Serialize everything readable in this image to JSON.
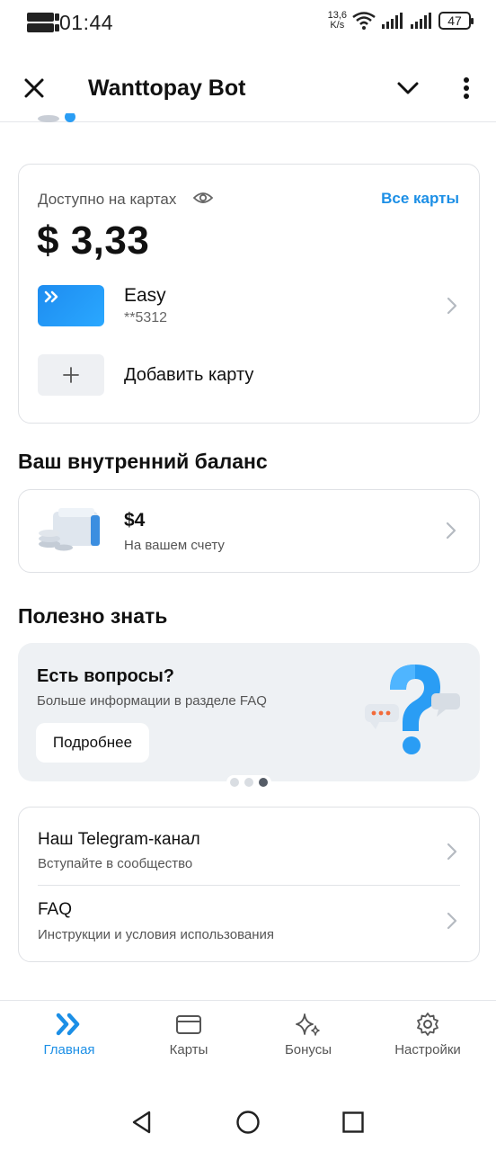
{
  "status_bar": {
    "time": "01:44",
    "net_speed_value": "13,6",
    "net_speed_unit": "K/s",
    "battery": "47",
    "sim_badge_1": "WiFi 1",
    "sim_badge_2": "WiFi 2"
  },
  "header": {
    "title": "Wanttopay Bot",
    "close_icon": "close-icon",
    "chevron_icon": "chevron-down-icon",
    "menu_icon": "more-vertical-icon"
  },
  "cards": {
    "available_label": "Доступно на картах",
    "all_cards_link": "Все карты",
    "balance": "$ 3,33",
    "card": {
      "name": "Easy",
      "number": "**5312"
    },
    "add_card_label": "Добавить карту"
  },
  "internal_balance": {
    "section_title": "Ваш внутренний баланс",
    "amount": "$4",
    "subtitle": "На вашем счету"
  },
  "useful": {
    "section_title": "Полезно знать",
    "banner": {
      "title": "Есть вопросы?",
      "subtitle": "Больше информации в разделе FAQ",
      "button": "Подробнее"
    },
    "carousel_active_index": 2,
    "carousel_count": 3
  },
  "links": [
    {
      "title": "Наш Telegram-канал",
      "subtitle": "Вступайте в сообщество"
    },
    {
      "title": "FAQ",
      "subtitle": "Инструкции и условия использования"
    }
  ],
  "bottom_nav": [
    {
      "label": "Главная",
      "icon": "home-chevrons-icon",
      "active": true
    },
    {
      "label": "Карты",
      "icon": "card-icon",
      "active": false
    },
    {
      "label": "Бонусы",
      "icon": "sparkles-icon",
      "active": false
    },
    {
      "label": "Настройки",
      "icon": "gear-icon",
      "active": false
    }
  ],
  "colors": {
    "accent": "#1c8fe6",
    "card_gradient_start": "#1e8cf0",
    "banner_bg": "#eef1f4"
  }
}
